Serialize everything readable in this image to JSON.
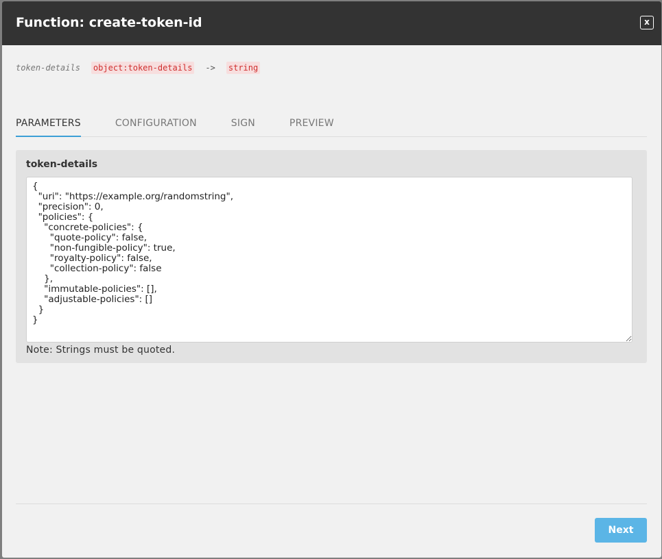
{
  "modal": {
    "title": "Function: create-token-id",
    "close_label": "x"
  },
  "signature": {
    "param_name": "token-details",
    "param_type": "object:token-details",
    "arrow": "->",
    "return_type": "string"
  },
  "tabs": [
    {
      "label": "PARAMETERS",
      "active": true
    },
    {
      "label": "CONFIGURATION",
      "active": false
    },
    {
      "label": "SIGN",
      "active": false
    },
    {
      "label": "PREVIEW",
      "active": false
    }
  ],
  "parameter": {
    "label": "token-details",
    "value": "{\n  \"uri\": \"https://example.org/randomstring\",\n  \"precision\": 0,\n  \"policies\": {\n    \"concrete-policies\": {\n      \"quote-policy\": false,\n      \"non-fungible-policy\": true,\n      \"royalty-policy\": false,\n      \"collection-policy\": false\n    },\n    \"immutable-policies\": [],\n    \"adjustable-policies\": []\n  }\n}",
    "note": "Note: Strings must be quoted."
  },
  "footer": {
    "next_label": "Next"
  },
  "colors": {
    "header_bg": "#333333",
    "accent": "#3b9fd6",
    "button": "#5bb5e6",
    "type_badge_bg": "#f7dede",
    "type_badge_text": "#d02f2f"
  }
}
